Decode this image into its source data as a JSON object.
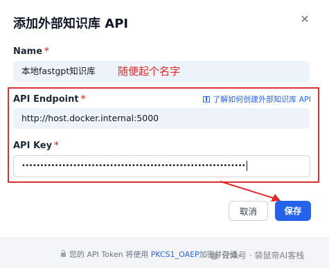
{
  "dialog": {
    "title": "添加外部知识库 API",
    "close_icon": "close-icon",
    "name_field": {
      "label": "Name",
      "required_mark": "*",
      "value": "本地fastgpt知识库"
    },
    "annotation": "随便起个名字",
    "endpoint_field": {
      "label": "API Endpoint",
      "required_mark": "*",
      "value": "http://host.docker.internal:5000",
      "help_link": "了解如何创建外部知识库 API",
      "help_icon": "book-icon"
    },
    "key_field": {
      "label": "API Key",
      "required_mark": "*",
      "value": "•••••••••••••••••••••••••••••••••••••••••••••••••••••••••••••"
    },
    "buttons": {
      "cancel": "取消",
      "save": "保存"
    },
    "footer": {
      "prefix": "您的 API Token 将使用",
      "algo": "PKCS1_OAEP",
      "suffix": "加密并存储。",
      "lock_icon": "lock-icon"
    },
    "watermark": "公众号 · 袋鼠帝AI客栈",
    "colors": {
      "accent": "#2563eb",
      "annotation_red": "#d93036",
      "required_red": "#ef4444"
    }
  }
}
